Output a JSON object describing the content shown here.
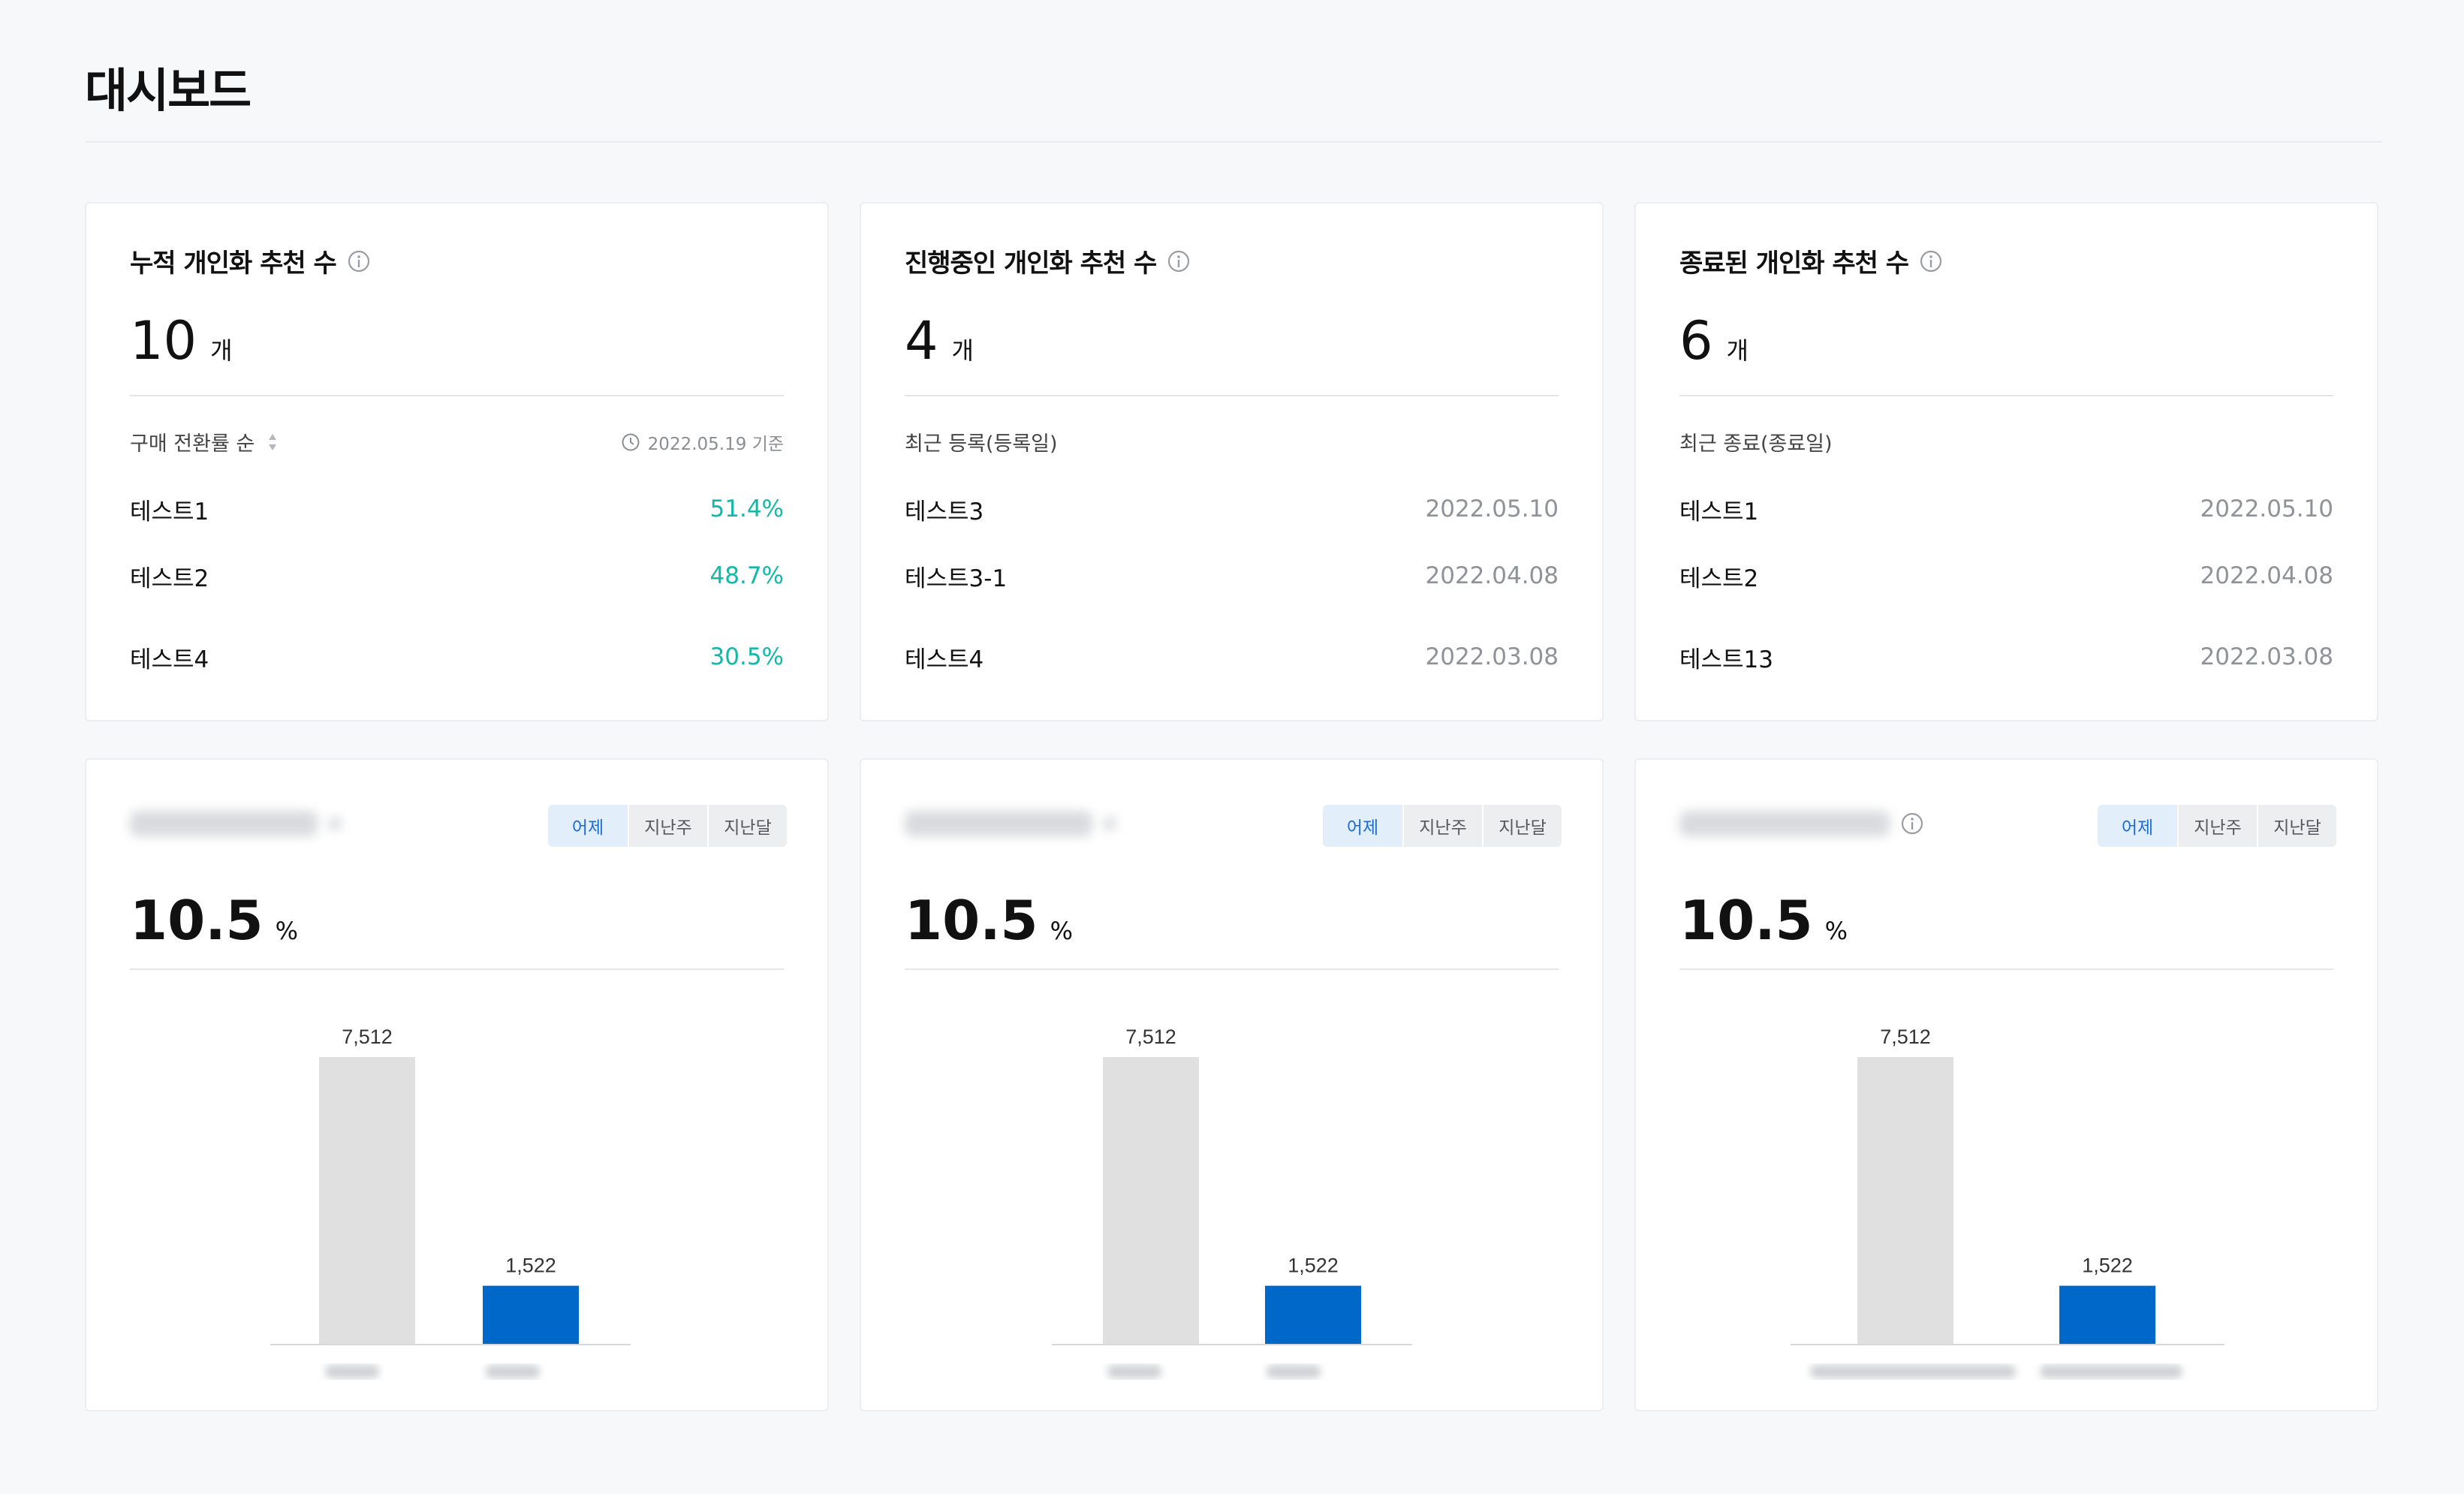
{
  "page": {
    "title": "대시보드"
  },
  "stat_cards": [
    {
      "title": "누적 개인화 추천 수",
      "count": "10",
      "unit": "개",
      "list_header": "구매 전환률 순",
      "basis": "2022.05.19 기준",
      "items": [
        {
          "name": "테스트1",
          "value": "51.4%"
        },
        {
          "name": "테스트2",
          "value": "48.7%"
        },
        {
          "name": "테스트4",
          "value": "30.5%"
        }
      ]
    },
    {
      "title": "진행중인 개인화 추천 수",
      "count": "4",
      "unit": "개",
      "list_header": "최근 등록(등록일)",
      "items": [
        {
          "name": "테스트3",
          "value": "2022.05.10"
        },
        {
          "name": "테스트3-1",
          "value": "2022.04.08"
        },
        {
          "name": "테스트4",
          "value": "2022.03.08"
        }
      ]
    },
    {
      "title": "종료된 개인화 추천 수",
      "count": "6",
      "unit": "개",
      "list_header": "최근 종료(종료일)",
      "items": [
        {
          "name": "테스트1",
          "value": "2022.05.10"
        },
        {
          "name": "테스트2",
          "value": "2022.04.08"
        },
        {
          "name": "테스트13",
          "value": "2022.03.08"
        }
      ]
    }
  ],
  "period_tabs": [
    "어제",
    "지난주",
    "지난달"
  ],
  "active_tab": "어제",
  "colors": {
    "accent": "#0068c9",
    "rate_green": "#13b9a8",
    "bar_gray": "#e0e0e0"
  },
  "icons": [
    "info-icon",
    "sort-icon",
    "clock-icon"
  ],
  "chart_cards": [
    {
      "rate": "10.5",
      "unit": "%"
    },
    {
      "rate": "10.5",
      "unit": "%"
    },
    {
      "rate": "10.5",
      "unit": "%"
    }
  ],
  "chart_data": [
    {
      "type": "bar",
      "categories": [
        "",
        ""
      ],
      "values": [
        7512,
        1522
      ],
      "value_labels": [
        "7,512",
        "1,522"
      ],
      "colors": [
        "#e0e0e0",
        "#0068c9"
      ],
      "title": "",
      "xlabel": "",
      "ylabel": "",
      "ylim": [
        0,
        7512
      ]
    },
    {
      "type": "bar",
      "categories": [
        "",
        ""
      ],
      "values": [
        7512,
        1522
      ],
      "value_labels": [
        "7,512",
        "1,522"
      ],
      "colors": [
        "#e0e0e0",
        "#0068c9"
      ],
      "title": "",
      "xlabel": "",
      "ylabel": "",
      "ylim": [
        0,
        7512
      ]
    },
    {
      "type": "bar",
      "categories": [
        "",
        ""
      ],
      "values": [
        7512,
        1522
      ],
      "value_labels": [
        "7,512",
        "1,522"
      ],
      "colors": [
        "#e0e0e0",
        "#0068c9"
      ],
      "title": "",
      "xlabel": "",
      "ylabel": "",
      "ylim": [
        0,
        7512
      ]
    }
  ]
}
